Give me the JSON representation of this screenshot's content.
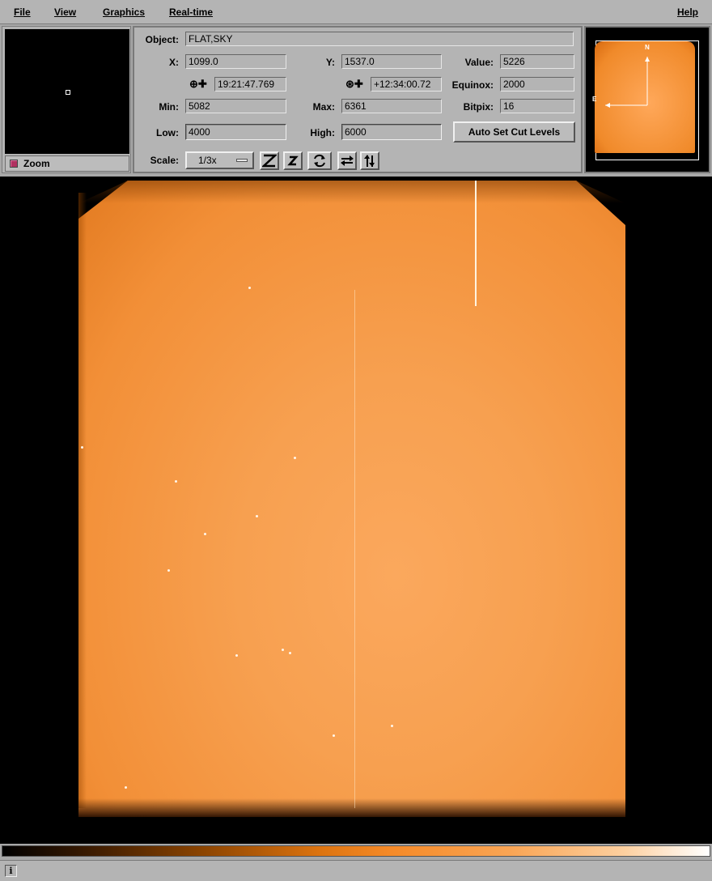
{
  "menubar": {
    "items": [
      {
        "label": "File"
      },
      {
        "label": "View"
      },
      {
        "label": "Graphics"
      },
      {
        "label": "Real-time"
      }
    ],
    "help": "Help"
  },
  "zoom": {
    "label": "Zoom"
  },
  "info": {
    "object_label": "Object:",
    "object_value": "FLAT,SKY",
    "x_label": "X:",
    "x_value": "1099.0",
    "y_label": "Y:",
    "y_value": "1537.0",
    "value_label": "Value:",
    "value_value": "5226",
    "ra_icon": "⊕✚",
    "ra_value": "19:21:47.769",
    "dec_icon": "⊛✚",
    "dec_value": "+12:34:00.72",
    "equinox_label": "Equinox:",
    "equinox_value": "2000",
    "min_label": "Min:",
    "min_value": "5082",
    "max_label": "Max:",
    "max_value": "6361",
    "bitpix_label": "Bitpix:",
    "bitpix_value": "16",
    "low_label": "Low:",
    "low_value": "4000",
    "high_label": "High:",
    "high_value": "6000",
    "auto_cut_label": "Auto Set Cut Levels",
    "scale_label": "Scale:",
    "scale_value": "1/3x"
  },
  "pan": {
    "north_label": "N",
    "east_label": "E"
  },
  "status": {
    "info_icon": "i"
  },
  "colors": {
    "accent": "#f29035",
    "panel": "#b4b4b4"
  }
}
